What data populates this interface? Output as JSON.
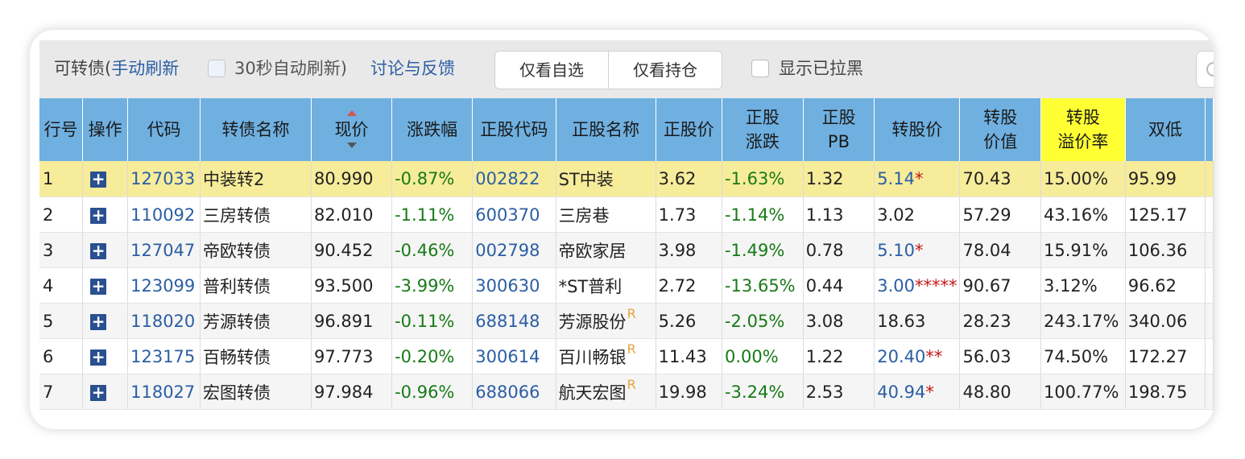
{
  "toolbar": {
    "title": "可转债(",
    "manual_refresh": "手动刷新",
    "auto_refresh_label": "30秒自动刷新)",
    "feedback_link": "讨论与反馈",
    "filter_watchlist": "仅看自选",
    "filter_holdings": "仅看持仓",
    "show_blacklisted": "显示已拉黑"
  },
  "columns": [
    "行号",
    "操作",
    "代码",
    "转债名称",
    "现价",
    "涨跌幅",
    "正股代码",
    "正股名称",
    "正股价",
    "正股涨跌",
    "正股PB",
    "转股价",
    "转股价值",
    "转股溢价率",
    "双低"
  ],
  "columns_display": {
    "stock_chg": [
      "正股",
      "涨跌"
    ],
    "stock_pb": [
      "正股",
      "PB"
    ],
    "conv_value": [
      "转股",
      "价值"
    ],
    "premium": [
      "转股",
      "溢价率"
    ]
  },
  "rows": [
    {
      "idx": "1",
      "code": "127033",
      "name": "中装转2",
      "price": "80.990",
      "chg": "-0.87%",
      "stock_code": "002822",
      "stock_name": "ST中装",
      "stock_tag": "",
      "stock_price": "3.62",
      "stock_chg": "-1.63%",
      "pb": "1.32",
      "conv_price": "5.14",
      "conv_mark": "*",
      "conv_value": "70.43",
      "premium": "15.00%",
      "double_low": "95.99"
    },
    {
      "idx": "2",
      "code": "110092",
      "name": "三房转债",
      "price": "82.010",
      "chg": "-1.11%",
      "stock_code": "600370",
      "stock_name": "三房巷",
      "stock_tag": "",
      "stock_price": "1.73",
      "stock_chg": "-1.14%",
      "pb": "1.13",
      "conv_price": "3.02",
      "conv_mark": "",
      "conv_value": "57.29",
      "premium": "43.16%",
      "double_low": "125.17"
    },
    {
      "idx": "3",
      "code": "127047",
      "name": "帝欧转债",
      "price": "90.452",
      "chg": "-0.46%",
      "stock_code": "002798",
      "stock_name": "帝欧家居",
      "stock_tag": "",
      "stock_price": "3.98",
      "stock_chg": "-1.49%",
      "pb": "0.78",
      "conv_price": "5.10",
      "conv_mark": "*",
      "conv_value": "78.04",
      "premium": "15.91%",
      "double_low": "106.36"
    },
    {
      "idx": "4",
      "code": "123099",
      "name": "普利转债",
      "price": "93.500",
      "chg": "-3.99%",
      "stock_code": "300630",
      "stock_name": "*ST普利",
      "stock_tag": "",
      "stock_price": "2.72",
      "stock_chg": "-13.65%",
      "pb": "0.44",
      "conv_price": "3.00",
      "conv_mark": "*****",
      "conv_value": "90.67",
      "premium": "3.12%",
      "double_low": "96.62"
    },
    {
      "idx": "5",
      "code": "118020",
      "name": "芳源转债",
      "price": "96.891",
      "chg": "-0.11%",
      "stock_code": "688148",
      "stock_name": "芳源股份",
      "stock_tag": "R",
      "stock_price": "5.26",
      "stock_chg": "-2.05%",
      "pb": "3.08",
      "conv_price": "18.63",
      "conv_mark": "",
      "conv_value": "28.23",
      "premium": "243.17%",
      "double_low": "340.06"
    },
    {
      "idx": "6",
      "code": "123175",
      "name": "百畅转债",
      "price": "97.773",
      "chg": "-0.20%",
      "stock_code": "300614",
      "stock_name": "百川畅银",
      "stock_tag": "R",
      "stock_price": "11.43",
      "stock_chg": "0.00%",
      "pb": "1.22",
      "conv_price": "20.40",
      "conv_mark": "**",
      "conv_value": "56.03",
      "premium": "74.50%",
      "double_low": "172.27"
    },
    {
      "idx": "7",
      "code": "118027",
      "name": "宏图转债",
      "price": "97.984",
      "chg": "-0.96%",
      "stock_code": "688066",
      "stock_name": "航天宏图",
      "stock_tag": "R",
      "stock_price": "19.98",
      "stock_chg": "-3.24%",
      "pb": "2.53",
      "conv_price": "40.94",
      "conv_mark": "*",
      "conv_value": "48.80",
      "premium": "100.77%",
      "double_low": "198.75"
    }
  ],
  "colors": {
    "header_bg": "#6fb0e0",
    "header_highlight": "#ffff33",
    "row_highlight": "#f7ec9a",
    "link_blue": "#2b5ea4",
    "down_green": "#177a17",
    "mark_red": "#c41818",
    "tag_orange": "#e8a33c"
  },
  "icons": {
    "row_action": "plus-icon",
    "sort_indicator": "sort-desc-icon",
    "search": "search-icon"
  }
}
